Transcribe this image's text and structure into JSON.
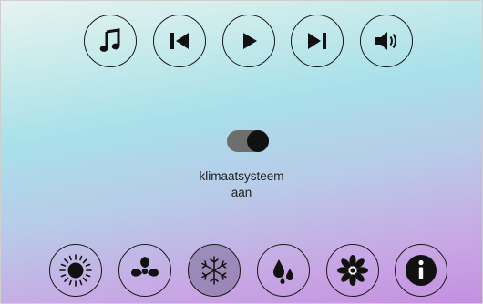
{
  "media_controls": {
    "items": [
      {
        "icon": "music-note-icon"
      },
      {
        "icon": "skip-previous-icon"
      },
      {
        "icon": "play-icon"
      },
      {
        "icon": "skip-next-icon"
      },
      {
        "icon": "volume-icon"
      }
    ]
  },
  "climate": {
    "toggle_on": true,
    "status_line1": "klimaatsysteem",
    "status_line2": "aan"
  },
  "mode_controls": {
    "items": [
      {
        "icon": "sun-icon",
        "active": false
      },
      {
        "icon": "fan-icon",
        "active": false
      },
      {
        "icon": "snowflake-icon",
        "active": true
      },
      {
        "icon": "water-drops-icon",
        "active": false
      },
      {
        "icon": "flower-icon",
        "active": false
      },
      {
        "icon": "info-icon",
        "active": false
      }
    ]
  },
  "colors": {
    "icon": "#111111",
    "active_button": "#7a6f96",
    "toggle_track": "#6e6e6e"
  }
}
